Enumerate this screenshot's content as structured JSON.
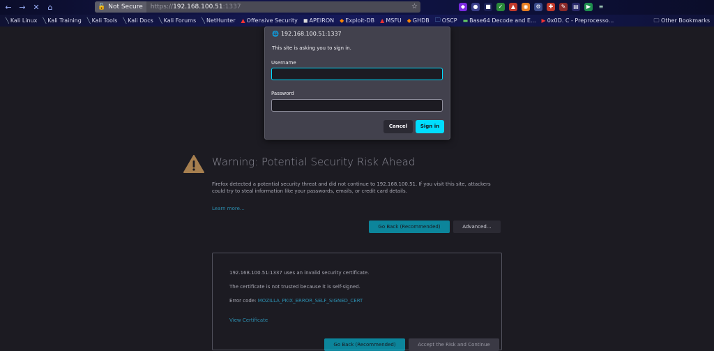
{
  "browser": {
    "nav": {
      "back": "←",
      "forward": "→",
      "stop": "✕",
      "home": "⌂"
    },
    "urlbar": {
      "security_label": "Not Secure",
      "url_scheme": "https://",
      "url_host": "192.168.100.51",
      "url_port": ":1337",
      "star": "☆"
    },
    "bookmarks": [
      {
        "label": "Kali Linux",
        "icon": "kali-icon"
      },
      {
        "label": "Kali Training",
        "icon": "kali-icon"
      },
      {
        "label": "Kali Tools",
        "icon": "kali-icon"
      },
      {
        "label": "Kali Docs",
        "icon": "kali-icon"
      },
      {
        "label": "Kali Forums",
        "icon": "kali-icon"
      },
      {
        "label": "NetHunter",
        "icon": "kali-icon"
      },
      {
        "label": "Offensive Security",
        "icon": "offsec-icon"
      },
      {
        "label": "APEIRON",
        "icon": "apeiron-icon"
      },
      {
        "label": "Exploit-DB",
        "icon": "exploitdb-icon"
      },
      {
        "label": "MSFU",
        "icon": "offsec-icon"
      },
      {
        "label": "GHDB",
        "icon": "exploitdb-icon"
      },
      {
        "label": "OSCP",
        "icon": "folder-icon"
      },
      {
        "label": "Base64 Decode and E...",
        "icon": "base64-icon"
      },
      {
        "label": "0x0D. C - Preprocesso...",
        "icon": "youtube-icon"
      }
    ],
    "other_bookmarks": "Other Bookmarks"
  },
  "auth_dialog": {
    "host": "192.168.100.51:1337",
    "message": "This site is asking you to sign in.",
    "username_label": "Username",
    "username_value": "",
    "password_label": "Password",
    "password_value": "",
    "cancel_label": "Cancel",
    "signin_label": "Sign in",
    "accent": "#00ddff"
  },
  "error_page": {
    "title": "Warning: Potential Security Risk Ahead",
    "description": "Firefox detected a potential security threat and did not continue to 192.168.100.51. If you visit this site, attackers could try to steal information like your passwords, emails, or credit card details.",
    "learn_more": "Learn more…",
    "go_back_label": "Go Back (Recommended)",
    "advanced_label": "Advanced…",
    "cert": {
      "line1": "192.168.100.51:1337 uses an invalid security certificate.",
      "line2": "The certificate is not trusted because it is self-signed.",
      "error_code_prefix": "Error code: ",
      "error_code": "MOZILLA_PKIX_ERROR_SELF_SIGNED_CERT",
      "view_certificate": "View Certificate",
      "go_back_label": "Go Back (Recommended)",
      "accept_label": "Accept the Risk and Continue"
    },
    "warning_color": "#a67f4f"
  }
}
